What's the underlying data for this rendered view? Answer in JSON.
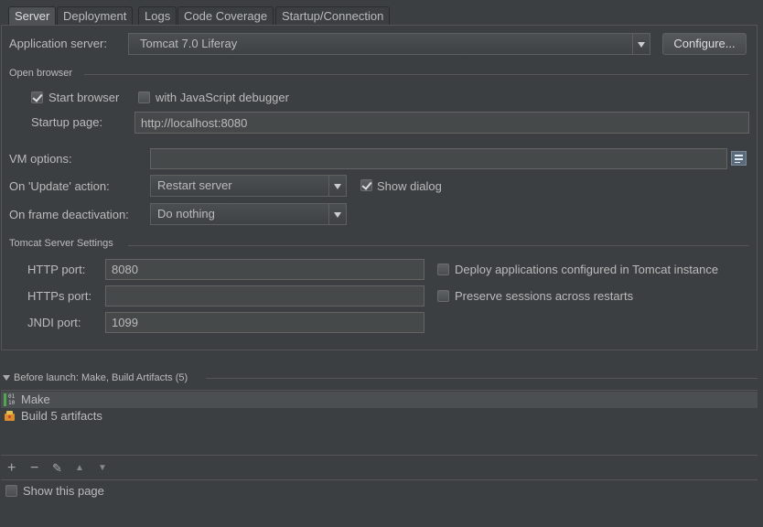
{
  "tabs": [
    {
      "label": "Server",
      "active": true
    },
    {
      "label": "Deployment",
      "active": false
    },
    {
      "label": "Logs",
      "active": false
    },
    {
      "label": "Code Coverage",
      "active": false
    },
    {
      "label": "Startup/Connection",
      "active": false
    }
  ],
  "app_server": {
    "label": "Application server:",
    "value": "Tomcat 7.0 Liferay",
    "configure_label": "Configure..."
  },
  "open_browser": {
    "section": "Open browser",
    "start_browser": {
      "label": "Start browser",
      "checked": true
    },
    "js_debugger": {
      "label": "with JavaScript debugger",
      "checked": false
    },
    "startup_page_label": "Startup page:",
    "startup_page_value": "http://localhost:8080"
  },
  "vm_options": {
    "label": "VM options:",
    "value": "",
    "icon": "expand-text-icon"
  },
  "update_action": {
    "label": "On 'Update' action:",
    "value": "Restart server",
    "show_dialog": {
      "label": "Show dialog",
      "checked": true
    }
  },
  "frame_deactivation": {
    "label": "On frame deactivation:",
    "value": "Do nothing"
  },
  "tomcat": {
    "section": "Tomcat Server Settings",
    "http_port_label": "HTTP port:",
    "http_port_value": "8080",
    "https_port_label": "HTTPs port:",
    "https_port_value": "",
    "jndi_port_label": "JNDI port:",
    "jndi_port_value": "1099",
    "deploy_apps": {
      "label": "Deploy applications configured in Tomcat instance",
      "checked": false
    },
    "preserve_sessions": {
      "label": "Preserve sessions across restarts",
      "checked": false
    }
  },
  "before_launch": {
    "title": "Before launch: Make, Build Artifacts (5)",
    "items": [
      {
        "label": "Make",
        "icon": "make-icon"
      },
      {
        "label": "Build 5 artifacts",
        "icon": "artifacts-icon"
      }
    ],
    "toolbar": {
      "add": "+",
      "remove": "−",
      "edit": "✎",
      "up": "▲",
      "down": "▼"
    }
  },
  "show_this_page": {
    "label": "Show this page",
    "checked": false
  }
}
